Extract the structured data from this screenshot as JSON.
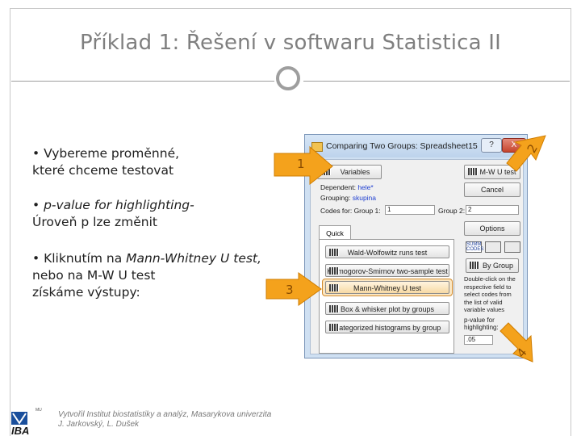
{
  "slide": {
    "title": "Příklad 1: Řešení v softwaru Statistica II",
    "bullets": {
      "b1_line1": "• Vybereme proměnné,",
      "b1_line2": "které chceme testovat",
      "b2_prefix": "• ",
      "b2_italic": "p-value for highlighting-",
      "b2_line2": "Úroveň p lze změnit",
      "b3_prefix": "• Kliknutím na ",
      "b3_italic1": "Mann-Whitney U test,",
      "b3_line2": "nebo na M-W U test",
      "b3_line3": "získáme výstupy:"
    },
    "arrow_labels": {
      "a1": "1",
      "a2": "2",
      "a3": "3",
      "a4": "4"
    },
    "footer": {
      "line1": "Vytvořil Institut biostatistiky a analýz, Masarykova univerzita",
      "line2": "J. Jarkovský, L. Dušek",
      "logo_text": "IBA",
      "logo_small": "MU"
    }
  },
  "dialog": {
    "title": "Comparing Two Groups: Spreadsheet15",
    "help": "?",
    "close": "X",
    "variables_button": "Variables",
    "mw_button": "M-W U test",
    "cancel_button": "Cancel",
    "options_button": "Options",
    "by_group_button": "By Group",
    "dependent_label": "Dependent:",
    "dependent_value": "hele*",
    "grouping_label": "Grouping:",
    "grouping_value": "skupina",
    "codes_label": "Codes for: Group 1:",
    "group1_value": "1",
    "group2_label": "Group 2:",
    "group2_value": "2",
    "tab_quick": "Quick",
    "buttons": [
      "Wald-Wolfowitz runs test",
      "Kolmogorov-Smirnov two-sample test",
      "Mann-Whitney U test",
      "Box & whisker plot by groups",
      "Categorized histograms by group"
    ],
    "note": "Double-click on the respective field to select codes from the list of valid variable values",
    "pvalue_label": "p-value for highlighting:",
    "pvalue_value": ".05",
    "summ_icon": "SUMM CODES",
    "accent": "#e69a2e"
  }
}
